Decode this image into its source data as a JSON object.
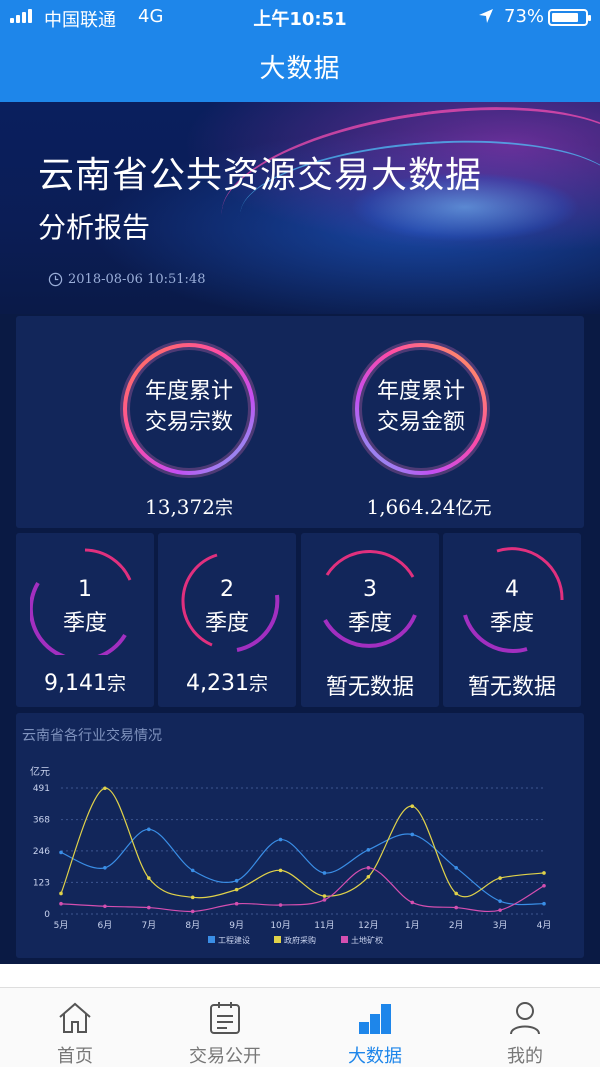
{
  "status_bar": {
    "carrier": "中国联通",
    "network": "4G",
    "time": "上午10:51",
    "battery": "73%"
  },
  "nav": {
    "title": "大数据"
  },
  "hero": {
    "title": "云南省公共资源交易大数据",
    "subtitle": "分析报告",
    "datetime": "2018-08-06 10:51:48"
  },
  "annual": {
    "count_line1": "年度累计",
    "count_line2": "交易宗数",
    "count_value": "13,372",
    "count_unit": "宗",
    "amount_line1": "年度累计",
    "amount_line2": "交易金额",
    "amount_value": "1,664.24",
    "amount_unit": "亿元"
  },
  "quarters": [
    {
      "num": "1",
      "label": "季度",
      "value": "9,141",
      "unit": "宗"
    },
    {
      "num": "2",
      "label": "季度",
      "value": "4,231",
      "unit": "宗"
    },
    {
      "num": "3",
      "label": "季度",
      "value": "暂无数据",
      "unit": ""
    },
    {
      "num": "4",
      "label": "季度",
      "value": "暂无数据",
      "unit": ""
    }
  ],
  "chart_title": "云南省各行业交易情况",
  "chart_data": {
    "type": "line",
    "title": "云南省各行业交易情况",
    "ylabel": "亿元",
    "xlabel": "",
    "ylim": [
      0,
      491
    ],
    "yticks": [
      0,
      123,
      246,
      368,
      491
    ],
    "categories": [
      "5月",
      "6月",
      "7月",
      "8月",
      "9月",
      "10月",
      "11月",
      "12月",
      "1月",
      "2月",
      "3月",
      "4月"
    ],
    "series": [
      {
        "name": "工程建设",
        "color": "#3a8ee6",
        "values": [
          240,
          180,
          330,
          170,
          130,
          290,
          160,
          250,
          310,
          180,
          50,
          40
        ]
      },
      {
        "name": "政府采购",
        "color": "#e0d24a",
        "values": [
          80,
          490,
          140,
          65,
          95,
          170,
          70,
          145,
          420,
          80,
          140,
          160
        ]
      },
      {
        "name": "土地矿权",
        "color": "#d44fb0",
        "values": [
          40,
          30,
          25,
          10,
          40,
          35,
          55,
          180,
          45,
          25,
          15,
          110
        ]
      }
    ],
    "legend_position": "bottom",
    "grid": true
  },
  "tabs": [
    {
      "label": "首页",
      "icon": "home-icon"
    },
    {
      "label": "交易公开",
      "icon": "clipboard-icon"
    },
    {
      "label": "大数据",
      "icon": "bigdata-icon"
    },
    {
      "label": "我的",
      "icon": "user-icon"
    }
  ],
  "colors": {
    "primary": "#1e86ea",
    "bg": "#0a1a44",
    "ring_pink": "#e0307e",
    "ring_purple": "#a22fc0"
  }
}
